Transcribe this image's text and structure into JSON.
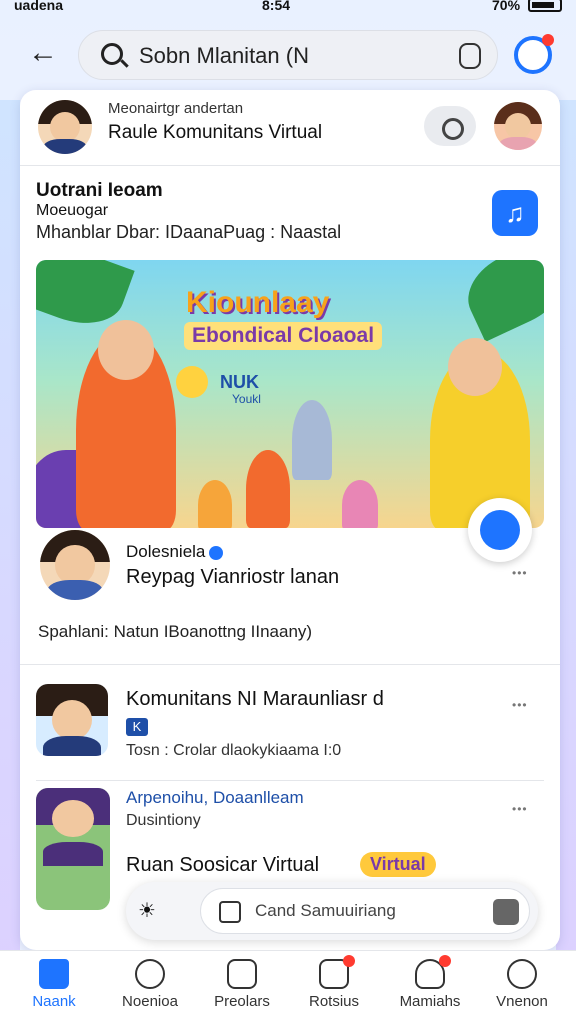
{
  "status": {
    "carrier": "uadena",
    "time": "8:54",
    "battery": "70%"
  },
  "search": {
    "query": "Sobn Mlanitan (N"
  },
  "header": {
    "sub": "Meonairtgr andertan",
    "title": "Raule Komunitans Virtual"
  },
  "post": {
    "author": "Uotrani Ieoam",
    "role": "Moeuogar",
    "meta": "Mhanblar Dbar: IDaanaPuag : Naastal",
    "banner_title": "Kiounlaay",
    "banner_subtitle": "Ebondical Cloaoal",
    "banner_small": "NUK",
    "banner_tiny": "Youkl",
    "byline_name": "Dolesniela",
    "byline_desc": "Reypag Vianriostr lanan",
    "caption": "Spahlani: Natun IBoanottng IInaany)",
    "dots": "•••"
  },
  "list": [
    {
      "title": "Komunitans NI Maraunliasr d",
      "tag": "K",
      "sub": "Tosn : Crolar dlaokykiaama I:0",
      "dots": "•••"
    },
    {
      "title": "Arpenoihu, Doaanlleam",
      "sub": "Dusintiony",
      "dots": "•••"
    }
  ],
  "promo": {
    "title": "Ruan Soosicar Virtual",
    "pill": "Virtual"
  },
  "composer": {
    "placeholder": "Cand Samuuiriang"
  },
  "nav": [
    {
      "label": "Naank"
    },
    {
      "label": "Noenioa"
    },
    {
      "label": "Preolars"
    },
    {
      "label": "Rotsius"
    },
    {
      "label": "Mamiahs"
    },
    {
      "label": "Vnenon"
    }
  ],
  "colors": {
    "accent": "#1e74ff",
    "badge": "#ff3b30"
  }
}
